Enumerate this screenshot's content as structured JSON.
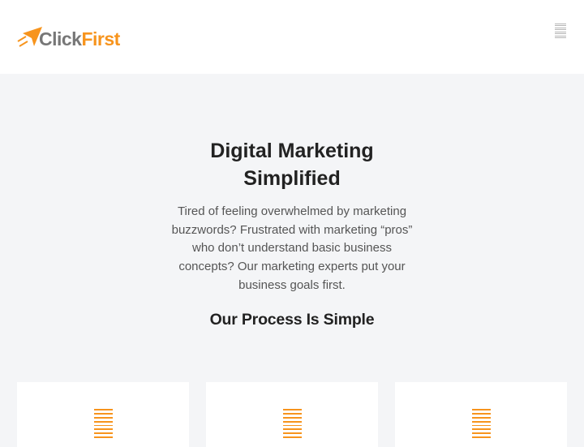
{
  "header": {
    "logo": {
      "part1": "Click",
      "part2": "First"
    },
    "menu_icon": "hamburger-icon"
  },
  "hero": {
    "title": "Digital Marketing Simplified",
    "body": "Tired of feeling overwhelmed by marketing buzzwords? Frustrated with marketing “pros” who don’t understand basic business concepts? Our marketing experts put your business goals first.",
    "section_title": "Our Process Is Simple"
  },
  "cards": [
    {
      "icon": "menu-lines-icon"
    },
    {
      "icon": "menu-lines-icon"
    },
    {
      "icon": "menu-lines-icon"
    }
  ],
  "colors": {
    "brand_orange": "#f7941d",
    "brand_gray": "#777777",
    "page_background": "#f4f5f7",
    "header_background": "#ffffff"
  }
}
